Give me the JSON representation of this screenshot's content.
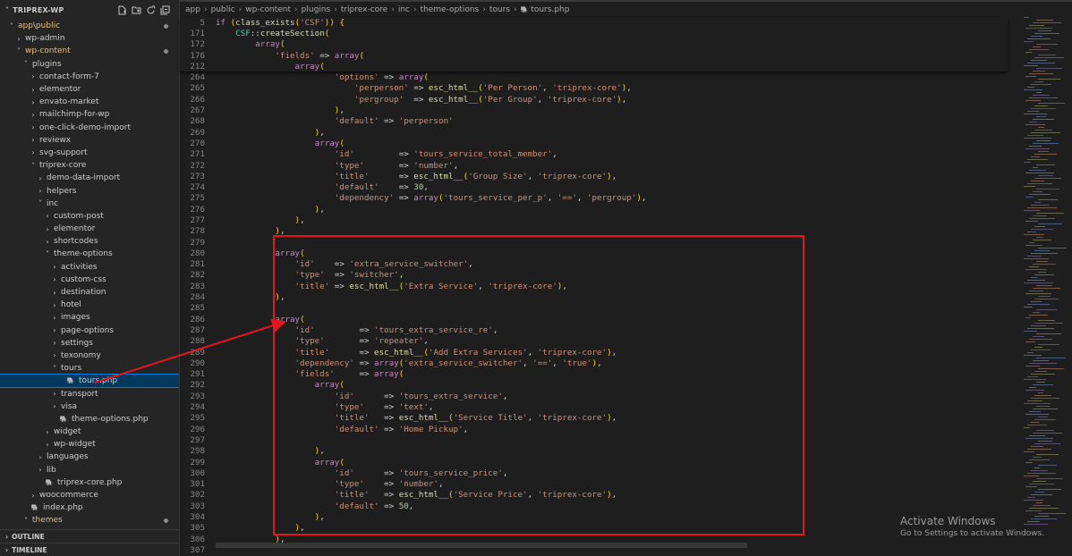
{
  "explorer": {
    "title": "TRIPREX-WP",
    "actions": [
      "new-file-icon",
      "new-folder-icon",
      "refresh-icon",
      "collapse-all-icon"
    ],
    "tree": [
      {
        "label": "app\\public",
        "depth": 1,
        "kind": "folder",
        "open": true,
        "modified": true
      },
      {
        "label": "wp-admin",
        "depth": 2,
        "kind": "folder",
        "open": false
      },
      {
        "label": "wp-content",
        "depth": 2,
        "kind": "folder",
        "open": true,
        "modified": true
      },
      {
        "label": "plugins",
        "depth": 3,
        "kind": "folder",
        "open": true
      },
      {
        "label": "contact-form-7",
        "depth": 4,
        "kind": "folder",
        "open": false
      },
      {
        "label": "elementor",
        "depth": 4,
        "kind": "folder",
        "open": false
      },
      {
        "label": "envato-market",
        "depth": 4,
        "kind": "folder",
        "open": false
      },
      {
        "label": "mailchimp-for-wp",
        "depth": 4,
        "kind": "folder",
        "open": false
      },
      {
        "label": "one-click-demo-import",
        "depth": 4,
        "kind": "folder",
        "open": false
      },
      {
        "label": "reviewx",
        "depth": 4,
        "kind": "folder",
        "open": false
      },
      {
        "label": "svg-support",
        "depth": 4,
        "kind": "folder",
        "open": false
      },
      {
        "label": "triprex-core",
        "depth": 4,
        "kind": "folder",
        "open": true
      },
      {
        "label": "demo-data-import",
        "depth": 5,
        "kind": "folder",
        "open": false
      },
      {
        "label": "helpers",
        "depth": 5,
        "kind": "folder",
        "open": false
      },
      {
        "label": "inc",
        "depth": 5,
        "kind": "folder",
        "open": true
      },
      {
        "label": "custom-post",
        "depth": 6,
        "kind": "folder",
        "open": false
      },
      {
        "label": "elementor",
        "depth": 6,
        "kind": "folder",
        "open": false
      },
      {
        "label": "shortcodes",
        "depth": 6,
        "kind": "folder",
        "open": false
      },
      {
        "label": "theme-options",
        "depth": 6,
        "kind": "folder",
        "open": true
      },
      {
        "label": "activities",
        "depth": 7,
        "kind": "folder",
        "open": false
      },
      {
        "label": "custom-css",
        "depth": 7,
        "kind": "folder",
        "open": false
      },
      {
        "label": "destination",
        "depth": 7,
        "kind": "folder",
        "open": false
      },
      {
        "label": "hotel",
        "depth": 7,
        "kind": "folder",
        "open": false
      },
      {
        "label": "images",
        "depth": 7,
        "kind": "folder",
        "open": false
      },
      {
        "label": "page-options",
        "depth": 7,
        "kind": "folder",
        "open": false
      },
      {
        "label": "settings",
        "depth": 7,
        "kind": "folder",
        "open": false
      },
      {
        "label": "texonomy",
        "depth": 7,
        "kind": "folder",
        "open": false
      },
      {
        "label": "tours",
        "depth": 7,
        "kind": "folder",
        "open": true
      },
      {
        "label": "tours.php",
        "depth": 8,
        "kind": "file",
        "selected": true
      },
      {
        "label": "transport",
        "depth": 7,
        "kind": "folder",
        "open": false
      },
      {
        "label": "visa",
        "depth": 7,
        "kind": "folder",
        "open": false
      },
      {
        "label": "theme-options.php",
        "depth": 7,
        "kind": "file"
      },
      {
        "label": "widget",
        "depth": 6,
        "kind": "folder",
        "open": false
      },
      {
        "label": "wp-widget",
        "depth": 6,
        "kind": "folder",
        "open": false
      },
      {
        "label": "languages",
        "depth": 5,
        "kind": "folder",
        "open": false
      },
      {
        "label": "lib",
        "depth": 5,
        "kind": "folder",
        "open": false
      },
      {
        "label": "triprex-core.php",
        "depth": 5,
        "kind": "file"
      },
      {
        "label": "woocommerce",
        "depth": 4,
        "kind": "folder",
        "open": false
      },
      {
        "label": "index.php",
        "depth": 3,
        "kind": "file"
      },
      {
        "label": "themes",
        "depth": 3,
        "kind": "folder",
        "open": true,
        "modified": true
      }
    ],
    "panels": [
      "OUTLINE",
      "TIMELINE"
    ]
  },
  "breadcrumb": [
    "app",
    "public",
    "wp-content",
    "plugins",
    "triprex-core",
    "inc",
    "theme-options",
    "tours",
    "tours.php"
  ],
  "editor": {
    "sticky_lines": [
      {
        "n": "5",
        "t": "if (class_exists('CSF')) {"
      },
      {
        "n": "171",
        "t": "    CSF::createSection("
      },
      {
        "n": "172",
        "t": "        array("
      },
      {
        "n": "176",
        "t": "            'fields' => array("
      },
      {
        "n": "212",
        "t": "                array("
      }
    ],
    "lines": [
      {
        "n": "264",
        "t": "                        'options' => array("
      },
      {
        "n": "265",
        "t": "                            'perperson' => esc_html__('Per Person', 'triprex-core'),"
      },
      {
        "n": "266",
        "t": "                            'pergroup'  => esc_html__('Per Group', 'triprex-core'),"
      },
      {
        "n": "267",
        "t": "                        ),"
      },
      {
        "n": "268",
        "t": "                        'default' => 'perperson'"
      },
      {
        "n": "269",
        "t": "                    ),"
      },
      {
        "n": "270",
        "t": "                    array("
      },
      {
        "n": "271",
        "t": "                        'id'         => 'tours_service_total_member',"
      },
      {
        "n": "272",
        "t": "                        'type'       => 'number',"
      },
      {
        "n": "273",
        "t": "                        'title'      => esc_html__('Group Size', 'triprex-core'),"
      },
      {
        "n": "274",
        "t": "                        'default'    => 30,"
      },
      {
        "n": "275",
        "t": "                        'dependency' => array('tours_service_per_p', '==', 'pergroup'),"
      },
      {
        "n": "276",
        "t": "                    ),"
      },
      {
        "n": "277",
        "t": "                ),"
      },
      {
        "n": "278",
        "t": "            ),"
      },
      {
        "n": "279",
        "t": ""
      },
      {
        "n": "280",
        "t": "            array("
      },
      {
        "n": "281",
        "t": "                'id'    => 'extra_service_switcher',"
      },
      {
        "n": "282",
        "t": "                'type'  => 'switcher',"
      },
      {
        "n": "283",
        "t": "                'title' => esc_html__('Extra Service', 'triprex-core'),"
      },
      {
        "n": "284",
        "t": "            ),"
      },
      {
        "n": "285",
        "t": ""
      },
      {
        "n": "286",
        "t": "            array("
      },
      {
        "n": "287",
        "t": "                'id'         => 'tours_extra_service_re',"
      },
      {
        "n": "288",
        "t": "                'type'       => 'repeater',"
      },
      {
        "n": "289",
        "t": "                'title'      => esc_html__('Add Extra Services', 'triprex-core'),"
      },
      {
        "n": "290",
        "t": "                'dependency' => array('extra_service_switcher', '==', 'true'),"
      },
      {
        "n": "291",
        "t": "                'fields'     => array("
      },
      {
        "n": "292",
        "t": "                    array("
      },
      {
        "n": "293",
        "t": "                        'id'      => 'tours_extra_service',"
      },
      {
        "n": "294",
        "t": "                        'type'    => 'text',"
      },
      {
        "n": "295",
        "t": "                        'title'   => esc_html__('Service Title', 'triprex-core'),"
      },
      {
        "n": "296",
        "t": "                        'default' => 'Home Pickup',"
      },
      {
        "n": "297",
        "t": ""
      },
      {
        "n": "298",
        "t": "                    ),"
      },
      {
        "n": "299",
        "t": "                    array("
      },
      {
        "n": "300",
        "t": "                        'id'      => 'tours_service_price',"
      },
      {
        "n": "301",
        "t": "                        'type'    => 'number',"
      },
      {
        "n": "302",
        "t": "                        'title'   => esc_html__('Service Price', 'triprex-core'),"
      },
      {
        "n": "303",
        "t": "                        'default' => 50,"
      },
      {
        "n": "304",
        "t": "                    ),"
      },
      {
        "n": "305",
        "t": "                ),"
      },
      {
        "n": "306",
        "t": "            ),"
      },
      {
        "n": "307",
        "t": ""
      }
    ]
  },
  "watermark": {
    "title": "Activate Windows",
    "subtitle": "Go to Settings to activate Windows."
  },
  "colors": {
    "annotation_red": "#e3161d",
    "selection_blue": "#04395e",
    "php_file_icon": "#a074c4"
  }
}
